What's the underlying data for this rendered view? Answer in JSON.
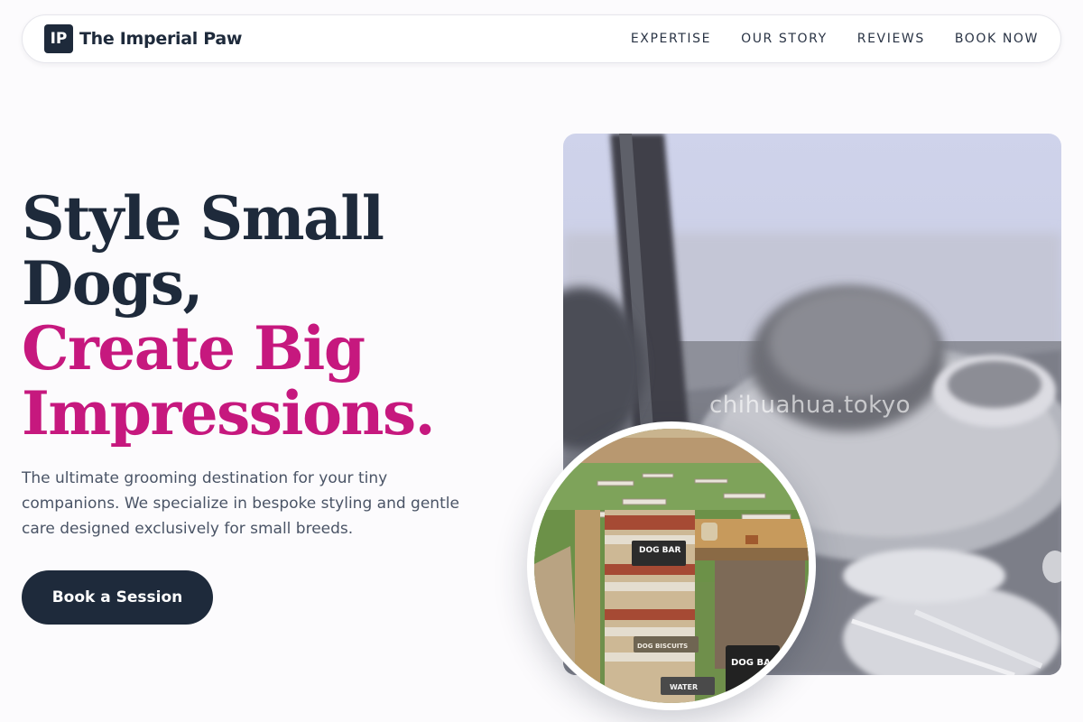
{
  "brand": {
    "badge": "IP",
    "name": "The Imperial Paw"
  },
  "nav": {
    "links": [
      {
        "label": "EXPERTISE"
      },
      {
        "label": "OUR STORY"
      },
      {
        "label": "REVIEWS"
      },
      {
        "label": "BOOK NOW"
      }
    ]
  },
  "hero": {
    "headline_dark": [
      "Style Small",
      "Dogs,"
    ],
    "headline_accent": [
      "Create Big",
      "Impressions."
    ],
    "description": "The ultimate grooming destination for your tiny companions. We specialize in bespoke styling and gentle care designed exclusively for small breeds.",
    "cta_label": "Book a Session"
  },
  "main_photo": {
    "watermark": "chihuahua.tokyo"
  },
  "circle_photo": {
    "signs": {
      "dog_bar_top": "DOG BAR",
      "dog_biscuits": "DOG BISCUITS",
      "water": "WATER",
      "dog_bar_bottom": "DOG BA"
    }
  },
  "colors": {
    "navy": "#1e2a3b",
    "magenta": "#c6187e",
    "background": "#fcfbfd"
  }
}
